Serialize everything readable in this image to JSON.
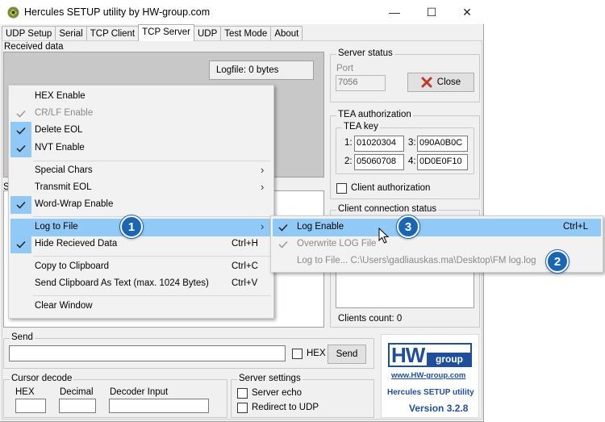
{
  "window": {
    "title": "Hercules SETUP utility by HW-group.com",
    "minimize": "—",
    "maximize": "☐",
    "close": "✕"
  },
  "tabs": [
    "UDP Setup",
    "Serial",
    "TCP Client",
    "TCP Server",
    "UDP",
    "Test Mode",
    "About"
  ],
  "received": {
    "label": "Received data",
    "logfile": "Logfile:  0 bytes"
  },
  "send_area": {
    "partial_label": "S"
  },
  "server_status": {
    "title": "Server status",
    "port_label": "Port",
    "port_value": "7056",
    "close_label": "Close"
  },
  "tea": {
    "title": "TEA authorization",
    "key_title": "TEA key",
    "k1_label": "1:",
    "k1": "01020304",
    "k2_label": "2:",
    "k2": "05060708",
    "k3_label": "3:",
    "k3": "090A0B0C",
    "k4_label": "4:",
    "k4": "0D0E0F10",
    "client_auth": "Client authorization"
  },
  "client_conn": {
    "title": "Client connection status",
    "count": "Clients count:  0"
  },
  "send": {
    "title": "Send",
    "hex": "HEX",
    "button": "Send"
  },
  "cursor": {
    "title": "Cursor decode",
    "hex": "HEX",
    "decimal": "Decimal",
    "decoder": "Decoder Input"
  },
  "server_settings": {
    "title": "Server settings",
    "echo": "Server echo",
    "redirect": "Redirect to UDP"
  },
  "logo": {
    "hw": "HW",
    "group": "group",
    "url": "www.HW-group.com",
    "product": "Hercules SETUP utility",
    "version": "Version  3.2.8"
  },
  "menu": {
    "hex_enable": "HEX Enable",
    "crlf_enable": "CR/LF Enable",
    "delete_eol": "Delete EOL",
    "nvt_enable": "NVT Enable",
    "special_chars": "Special Chars",
    "transmit_eol": "Transmit EOL",
    "word_wrap": "Word-Wrap Enable",
    "log_to_file": "Log to File",
    "hide_received": "Hide Recieved Data",
    "hide_received_sc": "Ctrl+H",
    "copy_clipboard": "Copy to Clipboard",
    "copy_clipboard_sc": "Ctrl+C",
    "send_clipboard": "Send Clipboard As Text (max. 1024 Bytes)",
    "send_clipboard_sc": "Ctrl+V",
    "clear_window": "Clear Window"
  },
  "submenu": {
    "log_enable": "Log Enable",
    "log_enable_sc": "Ctrl+L",
    "overwrite": "Overwrite LOG File",
    "log_to_file_path": "Log to File... C:\\Users\\gadliauskas.ma\\Desktop\\FM log.log"
  },
  "badges": {
    "b1": "1",
    "b2": "2",
    "b3": "3"
  },
  "colors": {
    "highlight": "#91c9f7",
    "badge": "#1b66b3",
    "close_x": "#c0392b",
    "logo_blue": "#1f4e9c"
  }
}
